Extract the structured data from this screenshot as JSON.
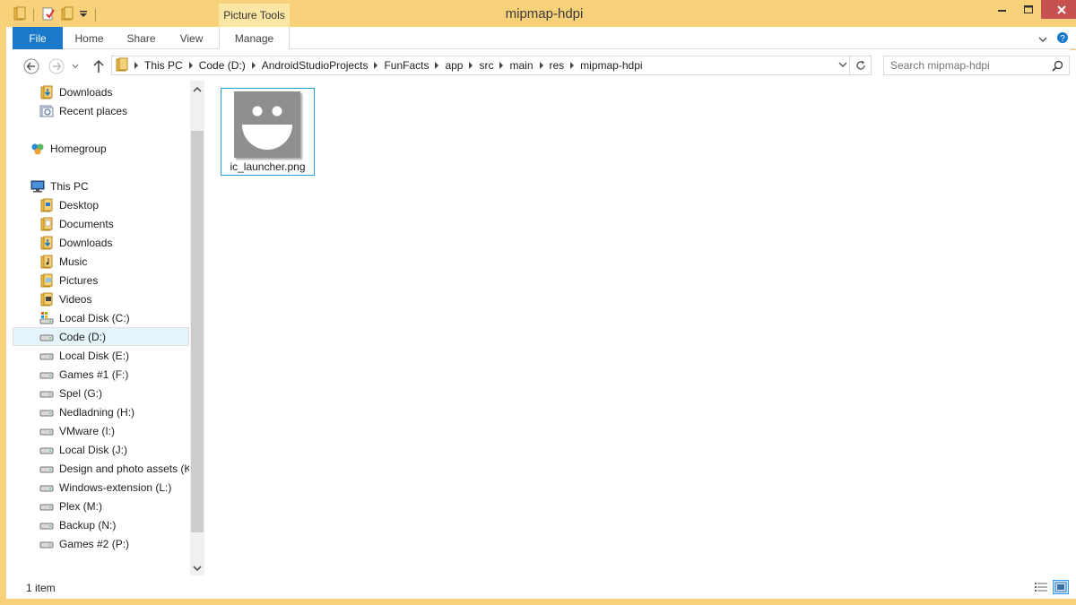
{
  "window": {
    "title": "mipmap-hdpi",
    "contextual_tab": "Picture Tools"
  },
  "ribbon": {
    "tabs": [
      {
        "label": "File"
      },
      {
        "label": "Home"
      },
      {
        "label": "Share"
      },
      {
        "label": "View"
      },
      {
        "label": "Manage"
      }
    ]
  },
  "address": {
    "crumbs": [
      "This PC",
      "Code (D:)",
      "AndroidStudioProjects",
      "FunFacts",
      "app",
      "src",
      "main",
      "res",
      "mipmap-hdpi"
    ]
  },
  "search": {
    "placeholder": "Search mipmap-hdpi"
  },
  "nav": {
    "items": [
      {
        "label": "Downloads",
        "icon": "downloads-folder-icon"
      },
      {
        "label": "Recent places",
        "icon": "recent-places-icon"
      },
      {
        "label": "Homegroup",
        "icon": "homegroup-icon"
      },
      {
        "label": "This PC",
        "icon": "computer-icon"
      },
      {
        "label": "Desktop",
        "icon": "folder-icon"
      },
      {
        "label": "Documents",
        "icon": "folder-icon"
      },
      {
        "label": "Downloads",
        "icon": "downloads-folder-icon"
      },
      {
        "label": "Music",
        "icon": "folder-icon"
      },
      {
        "label": "Pictures",
        "icon": "folder-icon"
      },
      {
        "label": "Videos",
        "icon": "folder-icon"
      },
      {
        "label": "Local Disk (C:)",
        "icon": "system-drive-icon"
      },
      {
        "label": "Code (D:)",
        "icon": "drive-icon",
        "selected": true
      },
      {
        "label": "Local Disk (E:)",
        "icon": "drive-icon"
      },
      {
        "label": "Games #1 (F:)",
        "icon": "drive-icon"
      },
      {
        "label": "Spel (G:)",
        "icon": "drive-icon"
      },
      {
        "label": "Nedladning (H:)",
        "icon": "drive-icon"
      },
      {
        "label": "VMware (I:)",
        "icon": "drive-icon"
      },
      {
        "label": "Local Disk (J:)",
        "icon": "drive-icon"
      },
      {
        "label": "Design and photo assets (K:",
        "icon": "drive-icon"
      },
      {
        "label": "Windows-extension (L:)",
        "icon": "drive-icon"
      },
      {
        "label": "Plex (M:)",
        "icon": "drive-icon"
      },
      {
        "label": "Backup (N:)",
        "icon": "drive-icon"
      },
      {
        "label": "Games #2 (P:)",
        "icon": "drive-icon"
      }
    ]
  },
  "content": {
    "files": [
      {
        "name": "ic_launcher.png",
        "icon": "launcher-smiley-icon"
      }
    ]
  },
  "status": {
    "item_count": "1 item"
  },
  "colors": {
    "title_bar": "#f8d27a",
    "file_tab": "#1979ca",
    "selection_border": "#26a0da",
    "close_button": "#c75050"
  }
}
